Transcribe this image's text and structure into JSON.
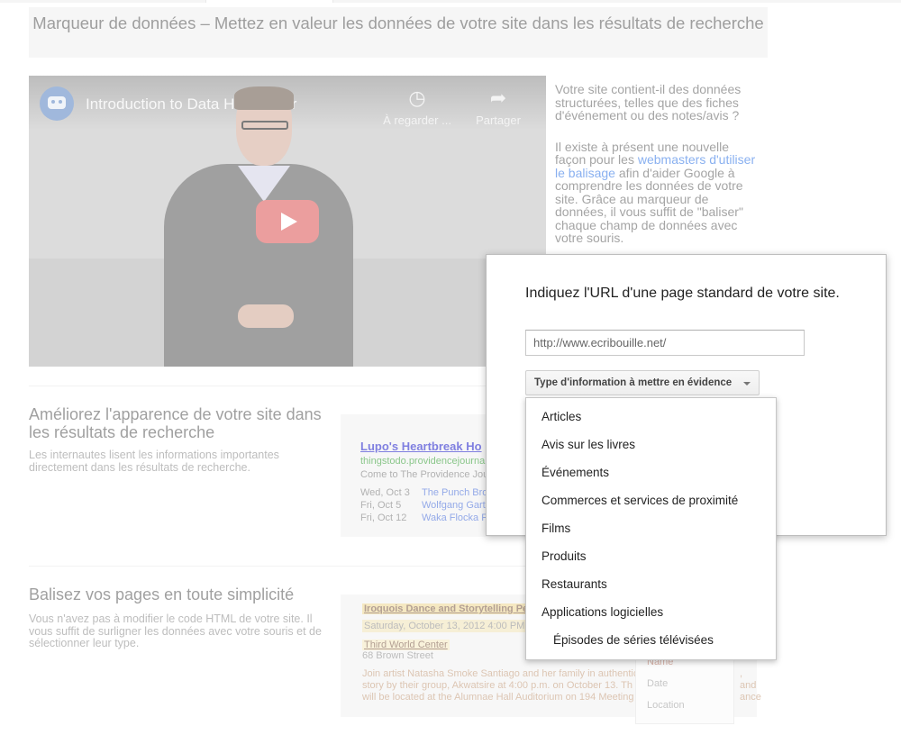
{
  "header": {
    "title": "Marqueur de données – Mettez en valeur les données de votre site dans les résultats de recherche"
  },
  "video": {
    "title": "Introduction to Data Highlighter",
    "watch_later_label": "À regarder ...",
    "share_label": "Partager"
  },
  "intro": {
    "p1": "Votre site contient-il des données structurées, telles que des fiches d'événement ou des notes/avis ?",
    "p2_before": "Il existe à présent une nouvelle façon pour les ",
    "p2_link": "webmasters d'utiliser le balisage",
    "p2_after": " afin d'aider Google à comprendre les données de votre site. Grâce au marqueur de données, il vous suffit de \"baliser\" chaque champ de données avec votre souris."
  },
  "section1": {
    "heading": "Améliorez l'apparence de votre site dans les résultats de recherche",
    "text": "Les internautes lisent les informations importantes directement dans les résultats de recherche."
  },
  "sample_result": {
    "title": "Lupo's Heartbreak Ho",
    "url": "thingstodo.providencejournal.",
    "snippet": "Come to The Providence Jou",
    "events": [
      {
        "date": "Wed, Oct 3",
        "name": "The Punch Bro"
      },
      {
        "date": "Fri, Oct 5",
        "name": "Wolfgang Gartn"
      },
      {
        "date": "Fri, Oct 12",
        "name": "Waka Flocka F"
      }
    ]
  },
  "section2": {
    "heading": "Balisez vos pages en toute simplicité",
    "text": "Vous n'avez pas à modifier le code HTML de votre site. Il vous suffit de surligner les données avec votre souris et de sélectionner leur type."
  },
  "highlighter_sample": {
    "title": "Iroquois Dance and Storytelling Pe",
    "date": "Saturday, October 13, 2012 4:00 PM",
    "venue": "Third World Center",
    "address": "68 Brown Street",
    "desc1": "Join artist Natasha Smoke Santiago and her family in authentic",
    "desc2": "story by their group, Akwatsire at 4:00 p.m. on October 13. Th",
    "desc3": "will be located at the Alumnae Hall Auditorium on 194 Meeting",
    "desc_right1": ", and",
    "desc_right2": "ance",
    "context_menu": [
      "Name",
      "Date",
      "Location"
    ]
  },
  "dialog": {
    "title": "Indiquez l'URL d'une page standard de votre site.",
    "url_value": "http://www.ecribouille.net/",
    "dropdown_label": "Type d'information à mettre en évidence",
    "menu_items": [
      "Articles",
      "Avis sur les livres",
      "Événements",
      "Commerces et services de proximité",
      "Films",
      "Produits",
      "Restaurants",
      "Applications logicielles",
      "Épisodes de séries télévisées"
    ]
  }
}
